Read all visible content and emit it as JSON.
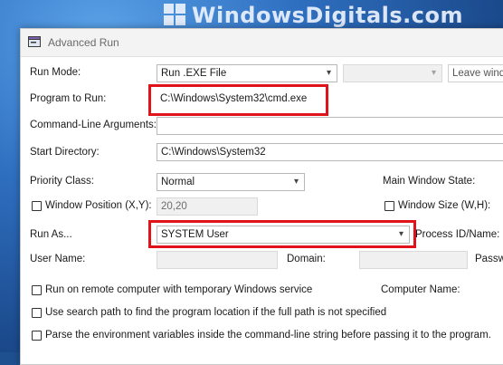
{
  "watermark": {
    "text": "WindowsDigitals.com"
  },
  "window": {
    "title": "Advanced Run"
  },
  "form": {
    "run_mode": {
      "label": "Run Mode:",
      "value": "Run .EXE File",
      "extra_value": "",
      "cut_text": "Leave windo"
    },
    "program": {
      "label": "Program to Run:",
      "value": "C:\\Windows\\System32\\cmd.exe"
    },
    "args": {
      "label": "Command-Line Arguments:",
      "value": ""
    },
    "start_dir": {
      "label": "Start Directory:",
      "value": "C:\\Windows\\System32"
    },
    "priority": {
      "label": "Priority Class:",
      "value": "Normal"
    },
    "main_window_state": {
      "label": "Main Window State:"
    },
    "window_position": {
      "label": "Window Position (X,Y):",
      "value": "20,20"
    },
    "window_size": {
      "label": "Window Size (W,H):"
    },
    "run_as": {
      "label": "Run As...",
      "value": "SYSTEM User"
    },
    "process_id": {
      "label": "Process ID/Name:"
    },
    "user_name": {
      "label": "User Name:"
    },
    "domain": {
      "label": "Domain:"
    },
    "password": {
      "label": "Passwo"
    },
    "remote": {
      "label": "Run on remote computer with temporary Windows service"
    },
    "computer_name": {
      "label": "Computer Name:"
    },
    "search_path": {
      "label": "Use search path to find the program location if the full path is not specified"
    },
    "parse_env": {
      "label": "Parse the environment variables inside the command-line string before passing it to the program."
    }
  },
  "highlight_color": "#e0131b"
}
